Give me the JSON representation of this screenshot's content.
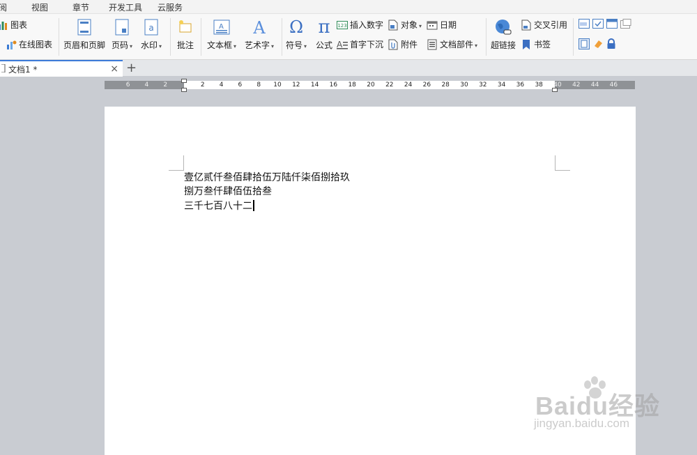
{
  "menu": [
    {
      "id": "review",
      "label": "阅"
    },
    {
      "id": "view",
      "label": "视图"
    },
    {
      "id": "chapter",
      "label": "章节"
    },
    {
      "id": "devtools",
      "label": "开发工具"
    },
    {
      "id": "cloud",
      "label": "云服务"
    }
  ],
  "ribbon": {
    "chart": "图表",
    "online_chart": "在线图表",
    "header_footer": "页眉和页脚",
    "page_number": "页码",
    "watermark": "水印",
    "comment": "批注",
    "textbox": "文本框",
    "wordart": "艺术字",
    "symbol": "符号",
    "formula": "公式",
    "insert_number": "插入数字",
    "drop_cap": "首字下沉",
    "object": "对象",
    "attachment": "附件",
    "date": "日期",
    "doc_parts": "文档部件",
    "hyperlink": "超链接",
    "cross_ref": "交叉引用",
    "bookmark": "书签",
    "symbol_omega": "Ω",
    "symbol_pi": "π",
    "icon_123": "123",
    "icon_a": "a",
    "icon_A": "A"
  },
  "tabs": {
    "doc_title": "文档1 *",
    "close": "×",
    "add": "+"
  },
  "ruler": {
    "left_ticks": [
      "6",
      "4",
      "2"
    ],
    "right_ticks": [
      "2",
      "4",
      "6",
      "8",
      "10",
      "12",
      "14",
      "16",
      "18",
      "20",
      "22",
      "24",
      "26",
      "28",
      "30",
      "32",
      "34",
      "36",
      "38",
      "40",
      "42",
      "44",
      "46"
    ]
  },
  "document": {
    "lines": [
      "壹亿贰仟叁佰肆拾伍万陆仟柒佰捌拾玖",
      "捌万叁仟肆佰伍拾叁",
      "三千七百八十二"
    ]
  },
  "watermark": {
    "main": "Baidu经验",
    "sub": "jingyan.baidu.com"
  },
  "colors": {
    "accent": "#3d7bd9",
    "ruler_dark": "#8f9296",
    "workspace": "#c9ccd2"
  }
}
